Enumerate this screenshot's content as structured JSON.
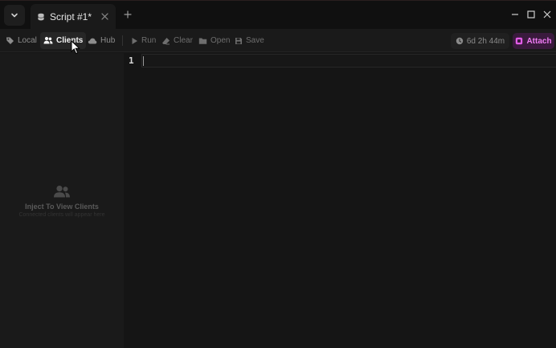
{
  "tabs": [
    {
      "label": "Script #1*",
      "icon": "database-icon"
    }
  ],
  "toolbar": {
    "local": "Local",
    "clients": "Clients",
    "hub": "Hub",
    "run": "Run",
    "clear": "Clear",
    "open": "Open",
    "save": "Save",
    "timer": "6d 2h 44m",
    "attach": "Attach"
  },
  "sidebar": {
    "empty_title": "Inject To View Clients",
    "empty_subtitle": "Connected clients will appear here"
  },
  "editor": {
    "line_numbers": [
      "1"
    ]
  },
  "colors": {
    "accent": "#f07cf5",
    "background": "#151515",
    "panel": "#1a1a1a"
  }
}
